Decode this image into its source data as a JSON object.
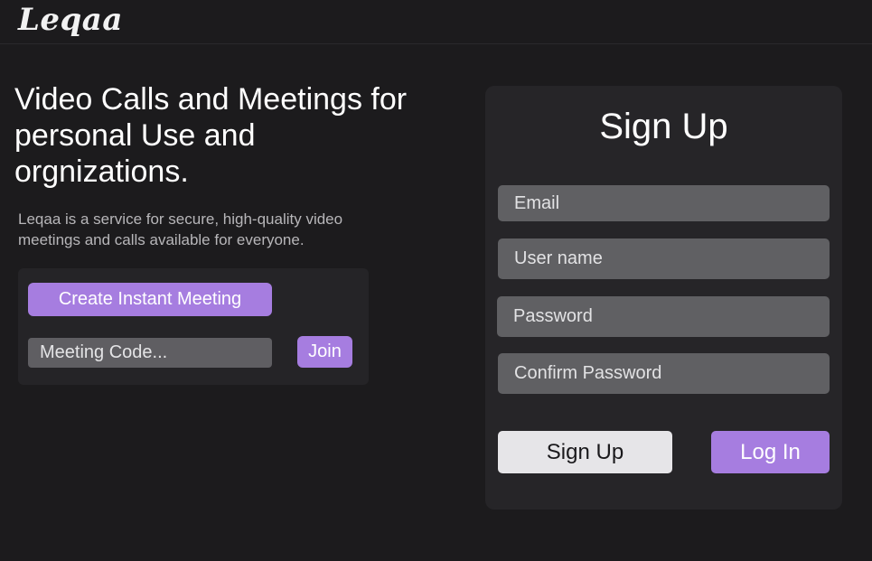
{
  "header": {
    "logo": "Leqaa"
  },
  "hero": {
    "title_line1": "Video Calls and Meetings for",
    "title_line2": "personal Use and",
    "title_line3": "orgnizations.",
    "description_line1": "Leqaa is a service for secure, high-quality video",
    "description_line2": "meetings and calls available for everyone."
  },
  "meeting": {
    "create_label": "Create Instant Meeting",
    "code_placeholder": "Meeting Code...",
    "join_label": "Join"
  },
  "signup": {
    "title": "Sign Up",
    "email_placeholder": "Email",
    "username_placeholder": "User name",
    "password_placeholder": "Password",
    "confirm_password_placeholder": "Confirm Password",
    "signup_label": "Sign Up",
    "login_label": "Log In"
  },
  "colors": {
    "background": "#1c1b1d",
    "card": "#262528",
    "accent": "#a67de0",
    "input": "#606063"
  }
}
